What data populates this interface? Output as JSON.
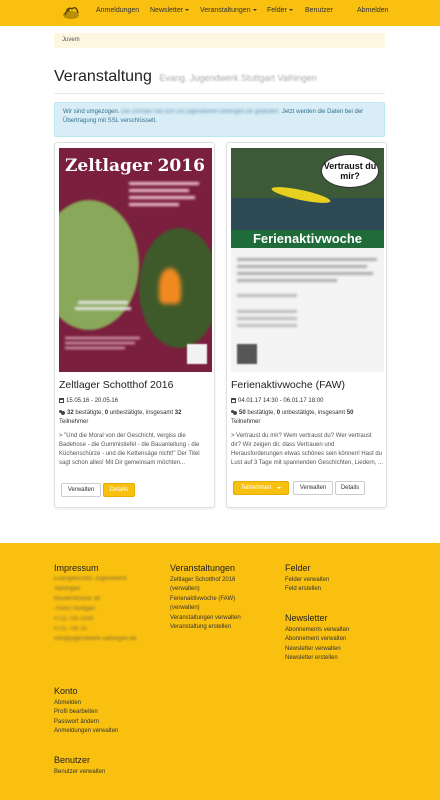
{
  "nav": {
    "items": [
      {
        "label": "Anmeldungen",
        "dropdown": false
      },
      {
        "label": "Newsletter",
        "dropdown": true
      },
      {
        "label": "Veranstaltungen",
        "dropdown": true
      },
      {
        "label": "Felder",
        "dropdown": true
      },
      {
        "label": "Benutzer",
        "dropdown": false
      }
    ],
    "logout": "Abmelden"
  },
  "breadcrumb": "Juvem",
  "page": {
    "title": "Veranstaltung",
    "subtitle": "Evang. Jugendwerk Stuttgart Vaihingen"
  },
  "alert": {
    "text_a": "Wir sind umgezogen.",
    "text_b": "Die Domain hat sich zur jugendwerk-vaihingen.de geändert.",
    "text_c": "Jetzt werden die Daten bei der Übertragung mit SSL verschlüsselt."
  },
  "events": [
    {
      "title": "Zeltlager Schotthof 2016",
      "date": "15.05.16 - 20.05.16",
      "confirmed": "32",
      "unconfirmed": "0",
      "total": "32",
      "stat_confirmed": " bestätigte, ",
      "stat_unconfirmed": " unbestätigte, insgesamt ",
      "stat_suffix": "Teilnehmer",
      "description": "> \"Und die Moral von der Geschicht, vergiss die Badehose - die Gummistiefel - die Bauanleitung - die Küchenschürze - und die Kettensäge nicht!\" Der Titel sagt schon alles! Mit Dir gemeinsam möchten...",
      "poster_title": "Zeltlager 2016",
      "buttons": [
        "Verwalten",
        "Details"
      ]
    },
    {
      "title": "Ferienaktivwoche (FAW)",
      "date": "04.01.17 14:30 - 06.01.17 18:00",
      "confirmed": "50",
      "unconfirmed": "0",
      "total": "50",
      "stat_confirmed": " bestätigte, ",
      "stat_unconfirmed": " unbestätigte, insgesamt ",
      "stat_suffix": "Teilnehmer",
      "description": "> Vertraust du mir? Wem vertraust du? Wer vertraust dir? Wir zeigen dir, dass Vertrauen und Herausforderungen etwas schönes sein können! Hast du Lust auf 3 Tage mit spannenden Geschichten, Liedern, ...",
      "poster_bubble": "Vertraust du mir?",
      "poster_banner": "Ferienaktivwoche",
      "buttons": [
        "Teilnehmen",
        "Verwalten",
        "Details"
      ]
    }
  ],
  "footer": {
    "impressum": {
      "heading": "Impressum",
      "lines": [
        "Evangelisches Jugendwerk",
        "Vaihingen",
        "Musterstrasse 38",
        "70563 Stuttgart",
        "0711 735 1535",
        "0711 735 15",
        "info@jugendwerk-vaihingen.de"
      ]
    },
    "veranstaltungen": {
      "heading": "Veranstaltungen",
      "links": [
        "Zeltlager Schotthof 2016",
        "(verwalten)",
        "Ferienaktivwoche (FAW)",
        "(verwalten)",
        "Veranstaltungen verwalten",
        "Veranstaltung erstellen"
      ]
    },
    "felder": {
      "heading": "Felder",
      "links": [
        "Felder verwalten",
        "Feld erstellen"
      ]
    },
    "newsletter": {
      "heading": "Newsletter",
      "links": [
        "Abonnements verwalten",
        "Abonnement verwalten",
        "Newsletter verwalten",
        "Newsletter erstellen"
      ]
    },
    "konto": {
      "heading": "Konto",
      "links": [
        "Abmelden",
        "Profil bearbeiten",
        "Passwort ändern",
        "Anmeldungen verwalten"
      ]
    },
    "benutzer": {
      "heading": "Benutzer",
      "links": [
        "Benutzer verwalten"
      ]
    }
  },
  "colors": {
    "brand": "#f9c010",
    "alert_bg": "#d9edf7",
    "poster1": "#7a1f3d",
    "poster2": "#1f6b3a"
  },
  "icons": [
    "logo-icon",
    "calendar-icon",
    "users-icon",
    "caret-down-icon"
  ]
}
